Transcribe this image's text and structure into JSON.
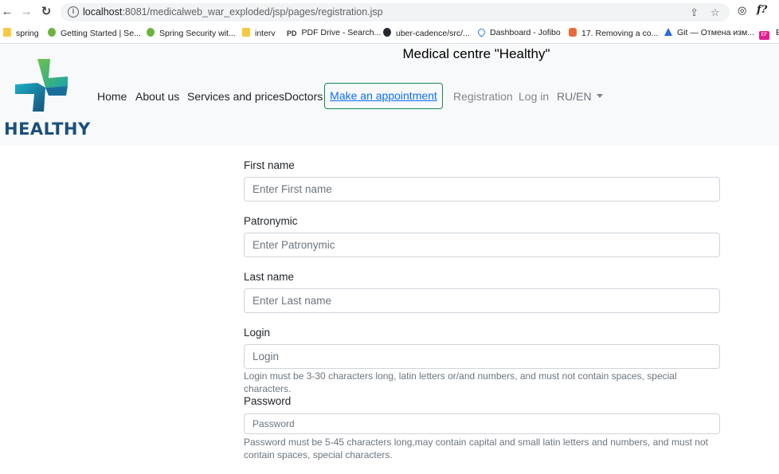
{
  "browser": {
    "url_host": "localhost",
    "url_rest": ":8081/medicalweb_war_exploded/jsp/pages/registration.jsp",
    "bookmarks": [
      {
        "label": "spring",
        "icon": "folder-icon"
      },
      {
        "label": "Getting Started | Se...",
        "icon": "spring-leaf-icon"
      },
      {
        "label": "Spring Security wit...",
        "icon": "spring-leaf-icon"
      },
      {
        "label": "interv",
        "icon": "folder-icon"
      },
      {
        "label": "PDF Drive - Search...",
        "icon": "pdf-icon"
      },
      {
        "label": "uber-cadence/src/...",
        "icon": "github-icon"
      },
      {
        "label": "Dashboard - Jofibo",
        "icon": "drop-icon"
      },
      {
        "label": "17. Removing a co...",
        "icon": "hand-icon"
      },
      {
        "label": "Git — Отмена изм...",
        "icon": "atlassian-icon"
      },
      {
        "label": "EF",
        "icon": "ef-icon"
      }
    ]
  },
  "site": {
    "title": "Medical centre \"Healthy\"",
    "logo_text": "HEALTHY",
    "nav": {
      "home": "Home",
      "about": "About us",
      "services": "Services and prices",
      "doctors": "Doctors",
      "appointment": "Make an appointment",
      "registration": "Registration",
      "login": "Log in",
      "lang": "RU/EN"
    }
  },
  "form": {
    "first_name": {
      "label": "First name",
      "placeholder": "Enter First name"
    },
    "patronymic": {
      "label": "Patronymic",
      "placeholder": "Enter Patronymic"
    },
    "last_name": {
      "label": "Last name",
      "placeholder": "Enter Last name"
    },
    "login": {
      "label": "Login",
      "placeholder": "Login",
      "help": "Login must be 3-30 characters long, latin letters or/and numbers, and must not contain spaces, special characters."
    },
    "password": {
      "label": "Password",
      "placeholder": "Password",
      "help": "Password must be 5-45 characters long,may contain capital and small latin letters and numbers, and must not contain spaces, special characters."
    }
  },
  "colors": {
    "header_bg": "#f8f9fa",
    "appointment_border": "#198754",
    "link_blue": "#0d6efd",
    "logo_blue": "#1a4f7a"
  }
}
